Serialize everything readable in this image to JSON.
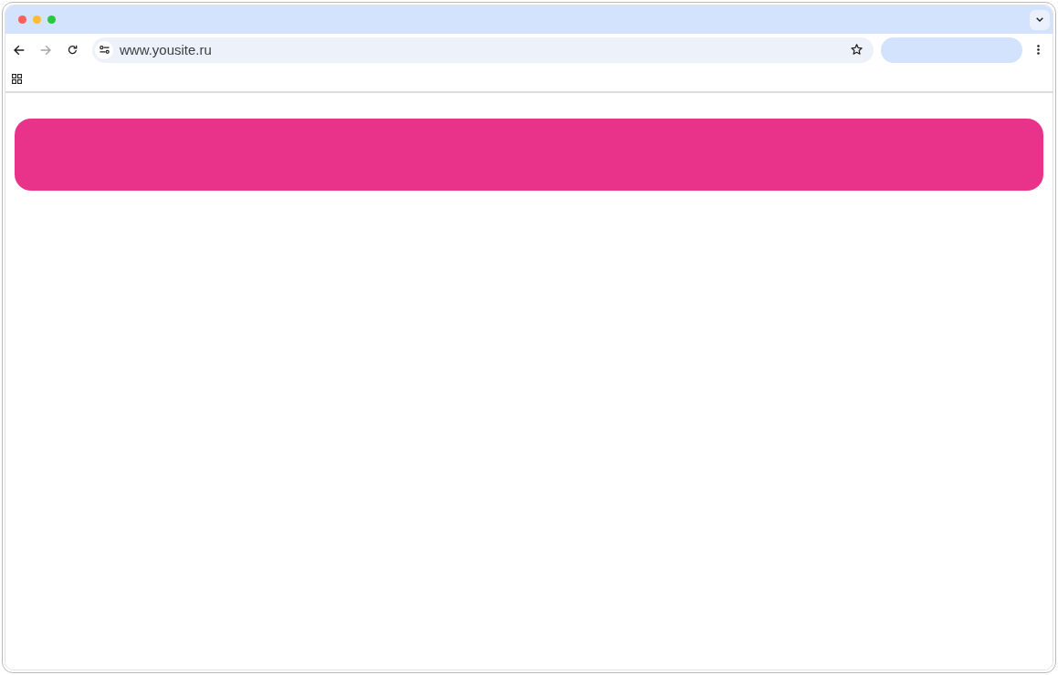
{
  "window": {
    "controls": [
      {
        "kind": "close"
      },
      {
        "kind": "minimize"
      },
      {
        "kind": "zoom"
      }
    ]
  },
  "toolbar": {
    "nav_buttons": [
      {
        "kind": "back",
        "disabled": false
      },
      {
        "kind": "forward",
        "disabled": true
      },
      {
        "kind": "reload",
        "disabled": false
      }
    ],
    "address": {
      "value": "www.yousite.ru"
    }
  }
}
